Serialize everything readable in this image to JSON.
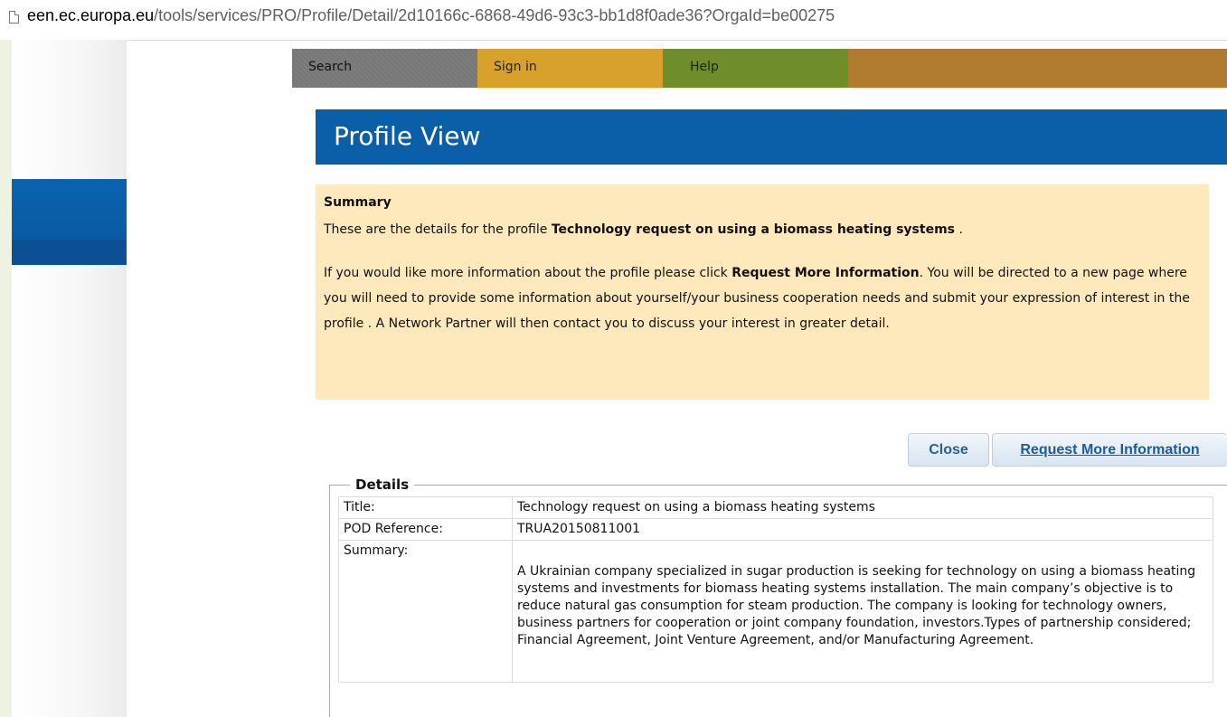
{
  "browser": {
    "url_host": "een.ec.europa.eu",
    "url_path": "/tools/services/PRO/Profile/Detail/2d10166c-6868-49d6-93c3-bb1d8f0ade36?OrgaId=be00275"
  },
  "nav": {
    "search": "Search",
    "signin": "Sign in",
    "help": "Help",
    "colors": {
      "search": "#7a7a7a",
      "signin": "#d7a12b",
      "help": "#6f8d2a",
      "extra": "#b07b2e"
    }
  },
  "page": {
    "title": "Profile View",
    "title_bg": "#0a5fa8"
  },
  "summary": {
    "heading": "Summary",
    "line1_prefix": "These are the details for the profile ",
    "line1_bold": "Technology request on using a biomass heating systems",
    "line1_suffix": " .",
    "para2_prefix": "If you would like more information about the profile please click ",
    "para2_bold": "Request More Information",
    "para2_suffix": ". You will be directed to a new page where you will need to provide some information about yourself/your business cooperation needs and submit your expression of interest in the profile . A Network Partner will then contact you to discuss your interest in greater detail.",
    "bg": "#fde9bb"
  },
  "buttons": {
    "close": "Close",
    "request": "Request More Information"
  },
  "details": {
    "legend": "Details",
    "rows": [
      {
        "label": "Title:",
        "value": "Technology request on using a biomass heating systems"
      },
      {
        "label": "POD Reference:",
        "value": "TRUA20150811001"
      },
      {
        "label": "Summary:",
        "value": "A Ukrainian company specialized in sugar production is seeking for technology on using a biomass heating systems and investments for biomass heating systems installation. The main company’s objective is to reduce natural gas consumption for steam production. The company is looking for technology owners, business partners for cooperation or joint company foundation, investors.Types of partnership considered; Financial Agreement, Joint Venture Agreement, and/or Manufacturing Agreement."
      }
    ]
  }
}
